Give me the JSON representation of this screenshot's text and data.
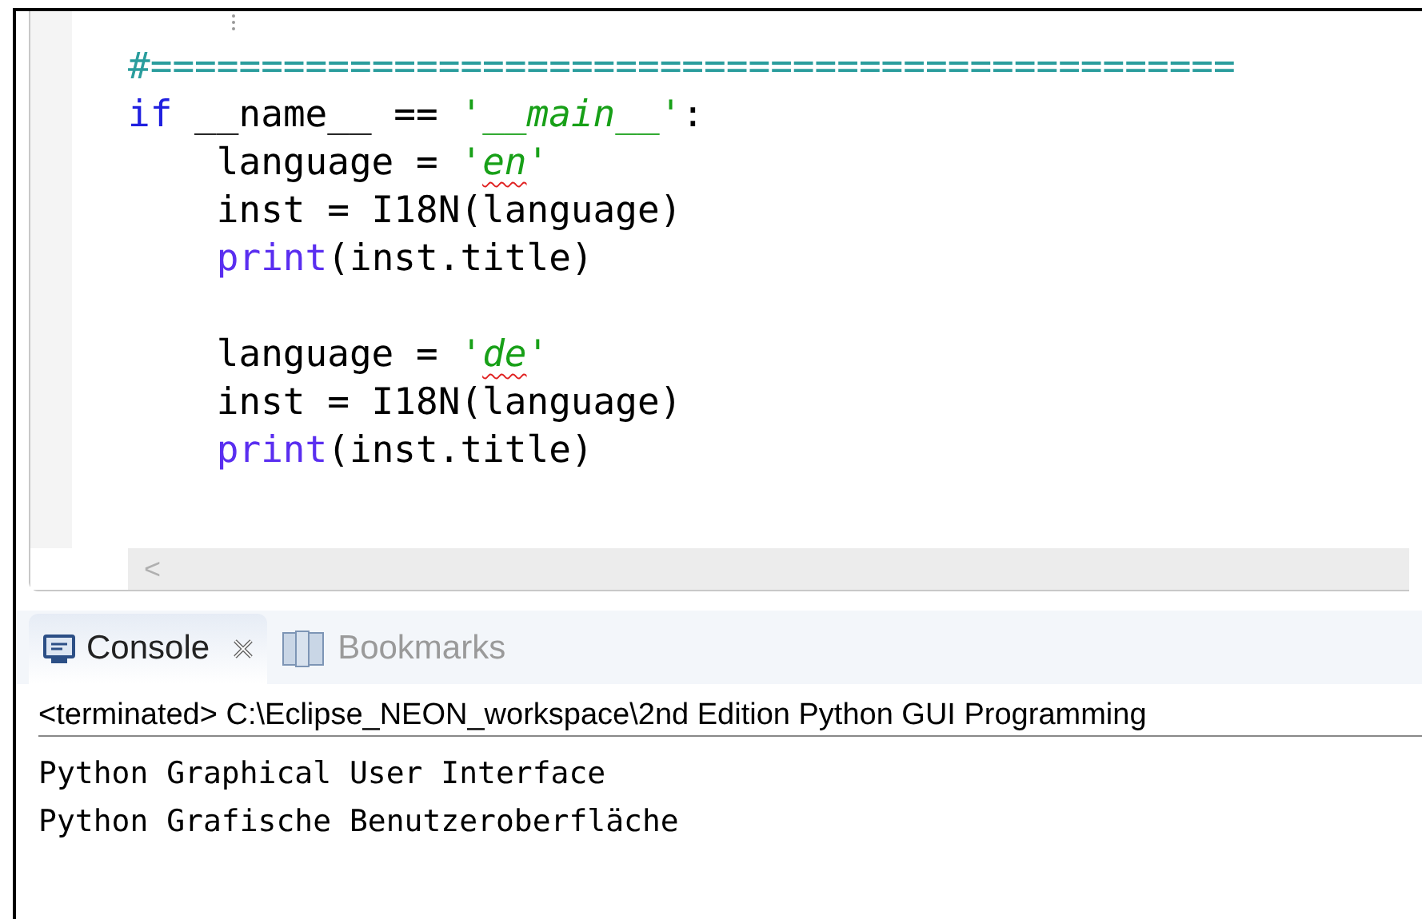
{
  "editor": {
    "lines": [
      {
        "kind": "code",
        "indented": false,
        "tokens": [
          {
            "kind": "comment",
            "text": "#================================================="
          }
        ]
      },
      {
        "kind": "code",
        "indented": false,
        "tokens": [
          {
            "kind": "keyword",
            "text": "if"
          },
          {
            "kind": "plain",
            "text": " __name__ == "
          },
          {
            "kind": "string",
            "text": "'__main__'"
          },
          {
            "kind": "plain",
            "text": ":"
          }
        ]
      },
      {
        "kind": "code",
        "indented": true,
        "tokens": [
          {
            "kind": "plain",
            "text": "language = "
          },
          {
            "kind": "string",
            "text": "'"
          },
          {
            "kind": "string",
            "text": "en",
            "spell_error": true
          },
          {
            "kind": "string",
            "text": "'"
          }
        ]
      },
      {
        "kind": "code",
        "indented": true,
        "tokens": [
          {
            "kind": "plain",
            "text": "inst = I18N(language)"
          }
        ]
      },
      {
        "kind": "code",
        "indented": true,
        "tokens": [
          {
            "kind": "builtin",
            "text": "print"
          },
          {
            "kind": "plain",
            "text": "(inst.title)"
          }
        ]
      },
      {
        "kind": "blank"
      },
      {
        "kind": "code",
        "indented": true,
        "tokens": [
          {
            "kind": "plain",
            "text": "language = "
          },
          {
            "kind": "string",
            "text": "'"
          },
          {
            "kind": "string",
            "text": "de",
            "spell_error": true
          },
          {
            "kind": "string",
            "text": "'"
          }
        ]
      },
      {
        "kind": "code",
        "indented": true,
        "tokens": [
          {
            "kind": "plain",
            "text": "inst = I18N(language)"
          }
        ]
      },
      {
        "kind": "code",
        "indented": true,
        "tokens": [
          {
            "kind": "builtin",
            "text": "print"
          },
          {
            "kind": "plain",
            "text": "(inst.title)"
          }
        ]
      }
    ],
    "scroll_left": "<"
  },
  "console": {
    "tabs": [
      {
        "label": "Console",
        "selected": true,
        "closable": true
      },
      {
        "label": "Bookmarks",
        "selected": false,
        "closable": false
      }
    ],
    "header": "<terminated> C:\\Eclipse_NEON_workspace\\2nd Edition Python GUI Programming",
    "output": [
      "Python Graphical User Interface",
      "Python Grafische Benutzeroberfläche"
    ]
  }
}
